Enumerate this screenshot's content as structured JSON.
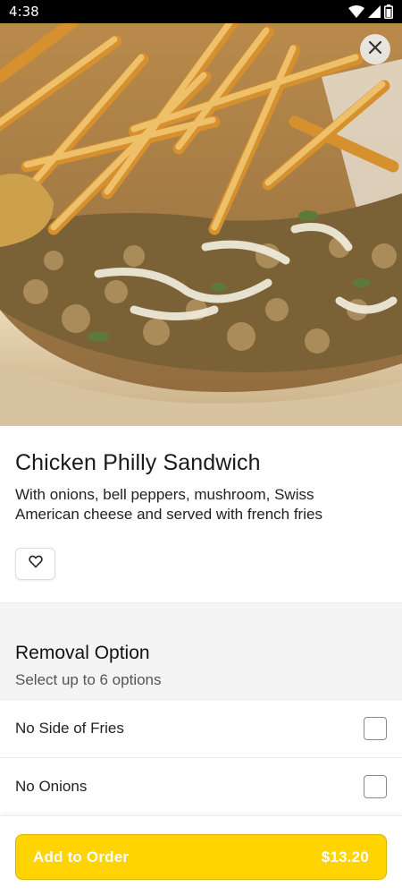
{
  "status_bar": {
    "time": "4:38",
    "icons": [
      "wifi-icon",
      "signal-icon",
      "battery-icon"
    ]
  },
  "hero": {
    "close_icon": "close-icon"
  },
  "item": {
    "title": "Chicken Philly Sandwich",
    "description": "With onions, bell peppers, mushroom, Swiss American cheese and served with french fries",
    "favorite_icon": "heart-icon"
  },
  "options": {
    "title": "Removal Option",
    "subtitle": "Select up to 6 options",
    "items": [
      {
        "label": "No Side of Fries",
        "checked": false
      },
      {
        "label": "No Onions",
        "checked": false
      }
    ]
  },
  "footer": {
    "button_label": "Add to Order",
    "price": "$13.20"
  },
  "colors": {
    "accent": "#ffd400",
    "button_text": "#ffffff",
    "status_bar": "#000000"
  }
}
